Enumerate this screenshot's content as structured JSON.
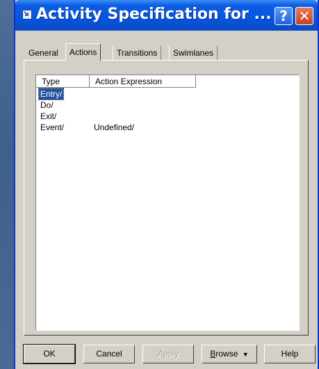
{
  "window": {
    "title": "Activity Specification for ...",
    "help_label": "?",
    "close_label": "✕",
    "app_icon": "spec-icon"
  },
  "tabs": [
    {
      "label": "General",
      "active": false
    },
    {
      "label": "Actions",
      "active": true
    },
    {
      "label": "Transitions",
      "active": false
    },
    {
      "label": "Swimlanes",
      "active": false
    }
  ],
  "actions_list": {
    "columns": [
      "Type",
      "Action Expression"
    ],
    "rows": [
      {
        "type": "Entry/",
        "expression": "",
        "selected": true
      },
      {
        "type": "Do/",
        "expression": ""
      },
      {
        "type": "Exit/",
        "expression": ""
      },
      {
        "type": "Event/",
        "expression": "Undefined/"
      }
    ]
  },
  "buttons": {
    "ok": "OK",
    "cancel": "Cancel",
    "apply": "Apply",
    "browse_first": "B",
    "browse_rest": "rowse",
    "browse_arrow": "▼",
    "help": "Help"
  },
  "colors": {
    "titlebar": "#0656e0",
    "selection": "#2152a0",
    "dialog_face": "#d4d0c8"
  }
}
